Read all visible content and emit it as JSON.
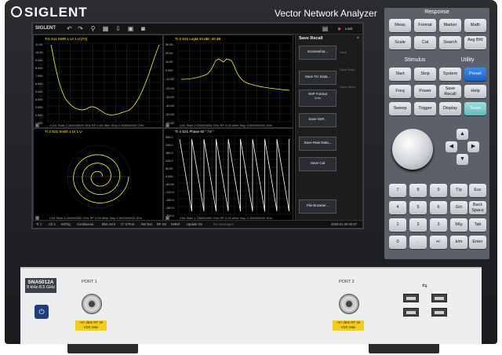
{
  "brand": "SIGLENT",
  "title": "Vector Network Analyzer",
  "screen": {
    "toolbar": {
      "logo": "SIGLENT",
      "lock": "Lock"
    },
    "traces": [
      {
        "header": "Tr1 S11 SWR 1 U/ 1 U [F2]",
        "footer": ">Ch1 Start 2.300000000 GHz   RF 0.00 dBm   Stop 2.500000000 GHz",
        "num": "1",
        "y_ticks": [
          "11.00",
          "10.00",
          "9.000",
          "8.000",
          "7.000",
          "6.000",
          "5.000",
          "4.000",
          "3.000",
          "2.000",
          "1.000"
        ]
      },
      {
        "header": "Tr 2  S21 LogM 10 dB/ -20 dB",
        "footer": "Ch2 Start 2.000000000 GHz   RF 0.00 dBm   Stop 3.000000000 GHz",
        "num": "2",
        "y_ticks": [
          "30.00",
          "20.00",
          "10.00",
          "0.000",
          "-10.00",
          "-20.00",
          "-30.00",
          "-40.00",
          "-50.00",
          "-60.00"
        ]
      },
      {
        "header": "Tr 3  S21 Smith 1 U/ 1 U",
        "footer": "Ch3 Start 2.000000000 GHz   RF 0.00 dBm   Stop 2.600000000 GHz",
        "num": "3",
        "y_ticks": []
      },
      {
        "header": "Tr 4  S21 Phase 60 ° / 0 °",
        "footer": "Ch4 Start 1.750000000 GHz   RF 0.00 dBm   Stop 2.250000000 GHz",
        "num": "4",
        "y_ticks": [
          "300.0",
          "240.0",
          "180.0",
          "120.0",
          "60.00",
          "0.000",
          "-60.00",
          "-120.0",
          "-180.0",
          "-240.0",
          "-300.0"
        ]
      }
    ],
    "panel": {
      "title": "Save Recall",
      "buttons": [
        "Screenshot...",
        "Save Trc Data...",
        "SnP Format",
        "Save SnP...",
        "Save Raw Data...",
        "Save Cal",
        "File Browser..."
      ],
      "snp_value": "Auto",
      "side_notes": [
        "Save",
        "Save State",
        "Save Other"
      ]
    },
    "status": [
      "Tr 1",
      "Ch 1",
      "IntTrig",
      "Continuous",
      "BW=10 k",
      "C* 2-Port",
      "Ref Ext",
      "RF On",
      "IntRef",
      "Update On",
      "No messages",
      "2020-01-29 02:37"
    ]
  },
  "keypad": {
    "response_title": "Response",
    "response": [
      "Meas",
      "Format",
      "Marker",
      "Math",
      "Scale",
      "Cal",
      "Search",
      "Avg BW"
    ],
    "stimulus_title": "Stimulus",
    "utility_title": "Utility",
    "stim_util": [
      "Start",
      "Stop",
      "System",
      "Preset",
      "Freq",
      "Power",
      "Save Recall",
      "Help",
      "Sweep",
      "Trigger",
      "Display",
      "Touch"
    ],
    "numeric": [
      "7",
      "8",
      "9",
      "T/p",
      "Esc",
      "4",
      "5",
      "6",
      "G/n",
      "Back Space",
      "1",
      "2",
      "3",
      "M/µ",
      "Tab",
      "0",
      ".",
      "+/-",
      "k/m",
      "Enter"
    ]
  },
  "front": {
    "model": "SNA5012A",
    "range": "9 kHz-8.5 GHz",
    "port1": "PORT 1",
    "port2": "PORT 2",
    "warning": "+27 dBm RF 35 VDC Max"
  }
}
